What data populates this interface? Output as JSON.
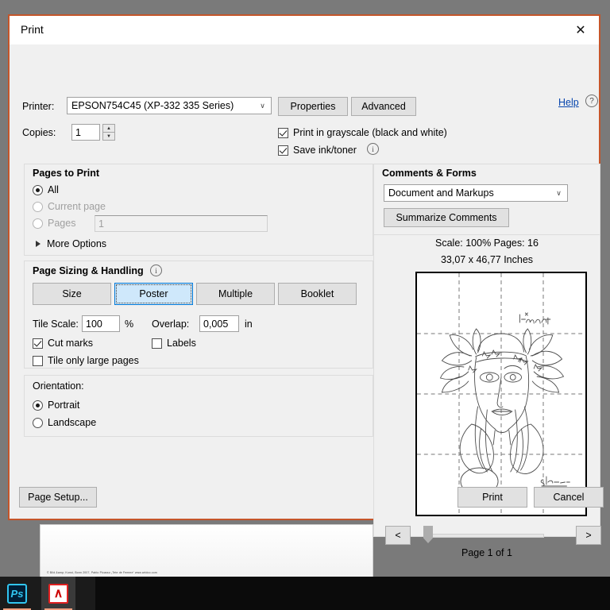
{
  "window": {
    "title": "Print",
    "close_icon": "close-icon",
    "border_color": "#c4552a"
  },
  "printer": {
    "label": "Printer:",
    "value": "EPSON754C45 (XP-332 335 Series)",
    "caret": "∨",
    "properties_label": "Properties",
    "advanced_label": "Advanced",
    "help_label": "Help",
    "help_icon": "?"
  },
  "copies": {
    "label": "Copies:",
    "value": "1",
    "spin_up": "▲",
    "spin_down": "▼"
  },
  "options": {
    "grayscale_label": "Print in grayscale (black and white)",
    "grayscale_checked": true,
    "saveink_label": "Save ink/toner",
    "saveink_checked": true,
    "saveink_info_icon": "i"
  },
  "pages_to_print": {
    "title": "Pages to Print",
    "all_label": "All",
    "all_selected": true,
    "current_page_label": "Current page",
    "current_page_selected": false,
    "pages_label": "Pages",
    "pages_selected": false,
    "pages_value": "1",
    "more_options_label": "More Options"
  },
  "page_sizing": {
    "title": "Page Sizing & Handling",
    "info_icon": "i",
    "tabs": [
      {
        "label": "Size",
        "selected": false
      },
      {
        "label": "Poster",
        "selected": true
      },
      {
        "label": "Multiple",
        "selected": false
      },
      {
        "label": "Booklet",
        "selected": false
      }
    ],
    "tile_scale_label": "Tile Scale:",
    "tile_scale_value": "100",
    "percent_unit": "%",
    "overlap_label": "Overlap:",
    "overlap_value": "0,005",
    "inch_unit": "in",
    "cut_marks_label": "Cut marks",
    "cut_marks_checked": true,
    "labels_label": "Labels",
    "labels_checked": false,
    "tile_only_label": "Tile only large pages",
    "tile_only_checked": false
  },
  "orientation": {
    "title": "Orientation:",
    "portrait_label": "Portrait",
    "portrait_selected": true,
    "landscape_label": "Landscape",
    "landscape_selected": false
  },
  "comments_forms": {
    "title": "Comments & Forms",
    "value": "Document and Markups",
    "caret": "∨",
    "summarize_label": "Summarize Comments"
  },
  "preview": {
    "scale_text": "Scale: 100% Pages: 16",
    "dimensions_text": "33,07 x 46,77 Inches",
    "page_indicator": "Page 1 of 1",
    "prev_label": "<",
    "next_label": ">",
    "artwork_note": "line-drawing portrait with foliage headdress and signature"
  },
  "footer": {
    "page_setup_label": "Page Setup...",
    "print_label": "Print",
    "cancel_label": "Cancel"
  },
  "desktop": {
    "background_caption": "© Bild &amp; Kunst, Bonn 2007, Pablo Picasso „Tete de Femme“  www.artdoo.com",
    "taskbar": [
      {
        "name": "photoshop",
        "glyph": "Ps"
      },
      {
        "name": "acrobat",
        "glyph": "A"
      }
    ]
  }
}
